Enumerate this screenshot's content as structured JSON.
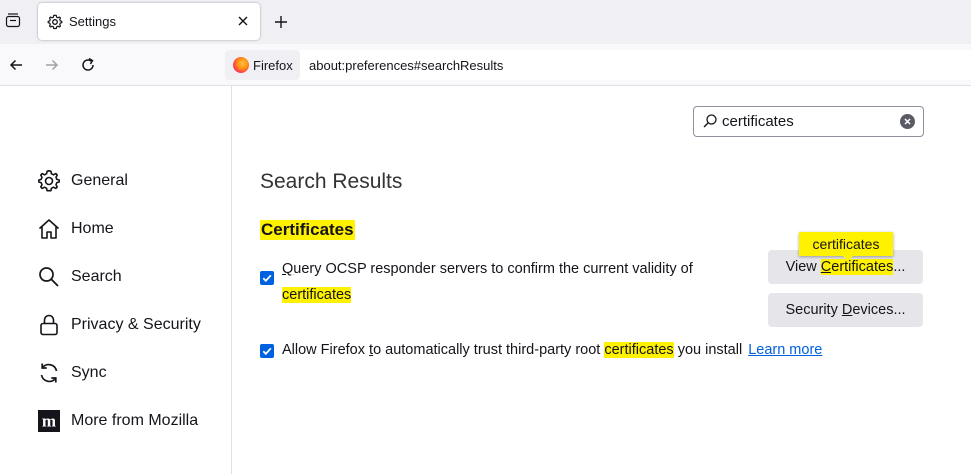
{
  "tabstrip": {
    "list_icon": "tab-list-icon",
    "new_tab_icon": "plus-icon"
  },
  "tab": {
    "title": "Settings",
    "icon": "gear-icon",
    "close_icon": "close-icon"
  },
  "navbar": {
    "back_icon": "back-arrow-icon",
    "forward_icon": "forward-arrow-icon",
    "reload_icon": "reload-icon",
    "identity_label": "Firefox",
    "url": "about:preferences#searchResults"
  },
  "search": {
    "value": "certificates"
  },
  "sidebar": {
    "items": [
      {
        "label": "General",
        "icon": "gear-icon"
      },
      {
        "label": "Home",
        "icon": "home-icon"
      },
      {
        "label": "Search",
        "icon": "search-icon"
      },
      {
        "label": "Privacy & Security",
        "icon": "lock-icon"
      },
      {
        "label": "Sync",
        "icon": "sync-icon"
      },
      {
        "label": "More from Mozilla",
        "icon": "mozilla-icon"
      }
    ]
  },
  "main": {
    "title": "Search Results",
    "section_heading": "Certificates",
    "ocsp": {
      "checked": true,
      "access_key": "Q",
      "text_rest": "uery OCSP responder servers to confirm the current validity of",
      "highlight": "certificates"
    },
    "trust": {
      "checked": true,
      "text_a": "Allow Firefox ",
      "access_key": "t",
      "text_b": "o automatically trust third-party root ",
      "highlight": "certificates",
      "text_c": " you install",
      "learn_more": "Learn more"
    },
    "view_button": {
      "prefix": "View ",
      "access_key": "C",
      "highlight_rest": "ertificates",
      "suffix": "..."
    },
    "devices_button": {
      "prefix": "Security ",
      "access_key": "D",
      "suffix": "evices..."
    },
    "tooltip": "certificates"
  },
  "colors": {
    "highlight": "#fff200",
    "accent": "#0061e0",
    "link": "#0061e0"
  }
}
